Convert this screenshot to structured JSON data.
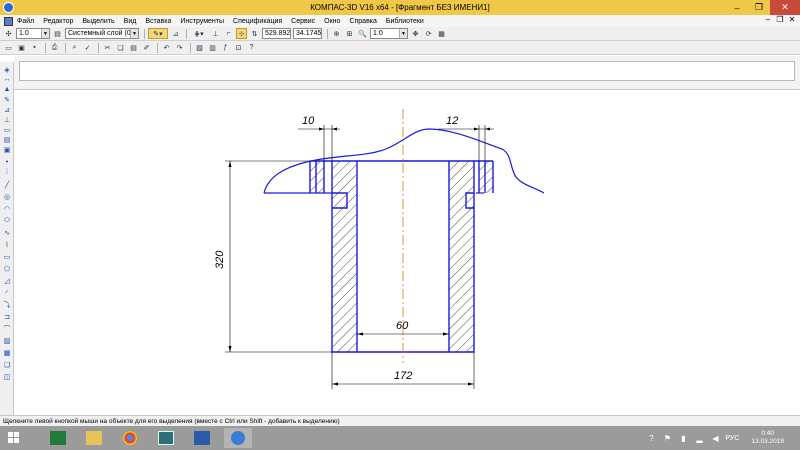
{
  "window": {
    "title": "КОМПАС-3D V16  x64 - [Фрагмент БЕЗ ИМЕНИ1]",
    "minimize_glyph": "–",
    "restore_glyph": "❐",
    "close_glyph": "✕"
  },
  "menu": {
    "items": [
      {
        "label": "Файл"
      },
      {
        "label": "Редактор"
      },
      {
        "label": "Выделить"
      },
      {
        "label": "Вид"
      },
      {
        "label": "Вставка"
      },
      {
        "label": "Инструменты"
      },
      {
        "label": "Спецификация"
      },
      {
        "label": "Сервис"
      },
      {
        "label": "Окно"
      },
      {
        "label": "Справка"
      },
      {
        "label": "Библиотеки"
      }
    ],
    "doc_minimize": "–",
    "doc_restore": "❐",
    "doc_close": "✕"
  },
  "toolbar1": {
    "scale": "1.0",
    "layer": "Системный слой (0)",
    "coord_x": "529.892",
    "coord_y": "34.1745",
    "zoom": "1.0"
  },
  "drawing": {
    "dim_hole_left": "10",
    "dim_hole_right": "12",
    "dim_height": "320",
    "dim_inner": "60",
    "dim_outer": "172"
  },
  "colors": {
    "outline": "#1a1adc",
    "hatch": "#000000",
    "axis": "#e08a1e",
    "dimension": "#000000"
  },
  "statusbar": {
    "message": "Щелкните левой кнопкой мыши на объекте для его выделения (вместе с Ctrl или Shift - добавить к выделению)"
  },
  "taskbar": {
    "language": "РУС",
    "time": "0:40",
    "date": "13.03.2018"
  }
}
